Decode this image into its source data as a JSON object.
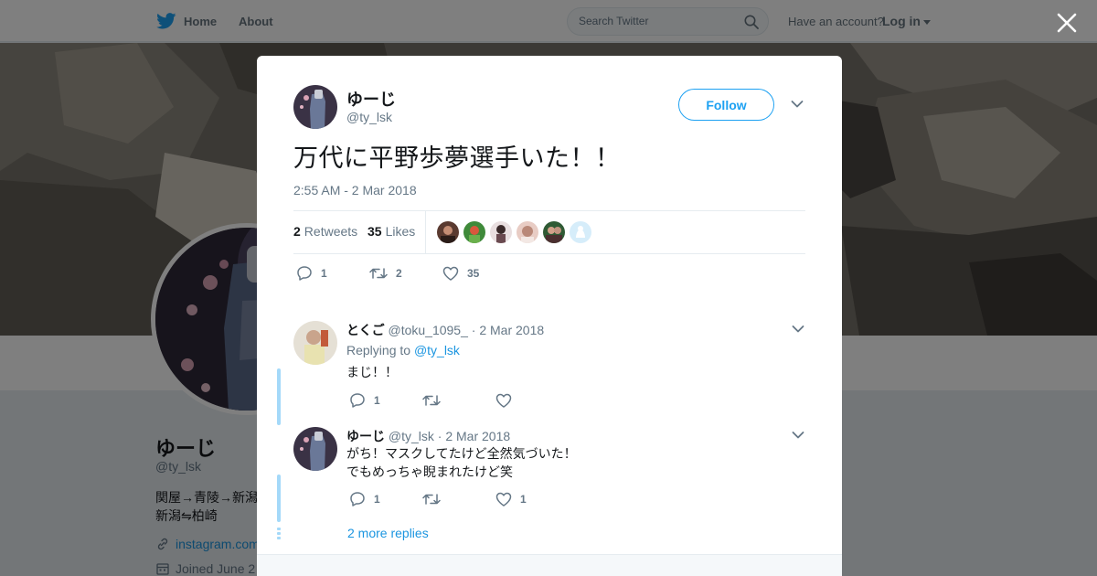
{
  "nav": {
    "home_label": "Home",
    "about_label": "About",
    "search_placeholder": "Search Twitter",
    "have_account": "Have an account?",
    "login_label": "Log in"
  },
  "profile": {
    "name": "ゆーじ",
    "handle": "@ty_lsk",
    "bio_line1": "関屋→青陵→新潟",
    "bio_line2": "新潟⇋柏崎",
    "link": "instagram.com",
    "joined": "Joined June 2"
  },
  "tweet": {
    "name": "ゆーじ",
    "handle": "@ty_lsk",
    "follow_label": "Follow",
    "text": "万代に平野歩夢選手いた！！",
    "timestamp": "2:55 AM - 2 Mar 2018",
    "retweets_count": "2",
    "retweets_label": "Retweets",
    "likes_count": "35",
    "likes_label": "Likes",
    "action_replies": "1",
    "action_retweets": "2",
    "action_likes": "35"
  },
  "replies": [
    {
      "name": "とくご",
      "handle": "@toku_1095_",
      "time": "· 2 Mar 2018",
      "replying_prefix": "Replying to",
      "replying_to": "@ty_lsk",
      "line1": "まじ！！",
      "reply_count": "1",
      "retweet_count": "",
      "like_count": ""
    },
    {
      "name": "ゆーじ",
      "handle": "@ty_lsk",
      "time": "· 2 Mar 2018",
      "line1": "がち！マスクしてたけど全然気づいた！",
      "line2": "でもめっちゃ睨まれたけど笑",
      "reply_count": "1",
      "retweet_count": "",
      "like_count": "1"
    }
  ],
  "more_replies_label": "2 more replies",
  "colors": {
    "brand": "#1da1f2",
    "link": "#1b95e0",
    "secondary_text": "#657786",
    "thread_line": "#a4d9f9"
  }
}
